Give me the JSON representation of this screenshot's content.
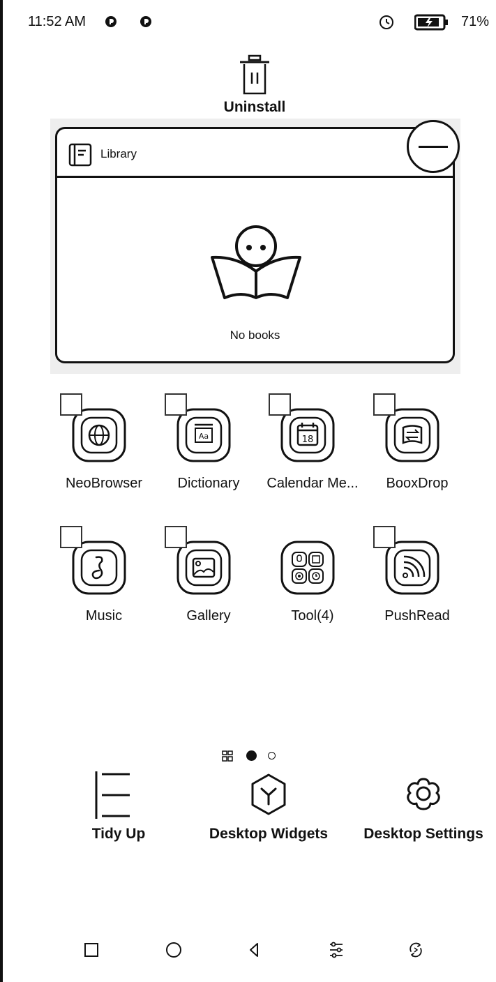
{
  "status_bar": {
    "time": "11:52 AM",
    "icons": [
      "notification-icon",
      "notification-icon",
      "timer-icon",
      "battery-charging-icon"
    ],
    "battery_percent": "71%"
  },
  "uninstall": {
    "label": "Uninstall",
    "icon": "trash-icon"
  },
  "library_widget": {
    "title": "Library",
    "empty_text": "No books",
    "icon": "book-icon",
    "illustration": "reading-character-icon",
    "remove_icon": "minus-circle-icon"
  },
  "apps": [
    {
      "label": "NeoBrowser",
      "icon": "globe-icon"
    },
    {
      "label": "Dictionary",
      "icon": "dictionary-icon"
    },
    {
      "label": "Calendar Me...",
      "icon": "calendar-icon",
      "calendar_day": "18"
    },
    {
      "label": "BooxDrop",
      "icon": "transfer-icon"
    },
    {
      "label": "Music",
      "icon": "music-note-icon"
    },
    {
      "label": "Gallery",
      "icon": "image-icon"
    },
    {
      "label": "Tool(4)",
      "icon": "tools-folder-icon"
    },
    {
      "label": "PushRead",
      "icon": "rss-icon"
    }
  ],
  "pager": {
    "pages": 2,
    "current": 1
  },
  "dock": [
    {
      "label": "Tidy Up",
      "icon": "tidy-up-icon"
    },
    {
      "label": "Desktop Widgets",
      "icon": "widgets-icon"
    },
    {
      "label": "Desktop Settings",
      "icon": "settings-gear-icon"
    }
  ],
  "nav_bar": [
    "recents-icon",
    "home-icon",
    "back-icon",
    "adjust-icon",
    "refresh-icon"
  ]
}
